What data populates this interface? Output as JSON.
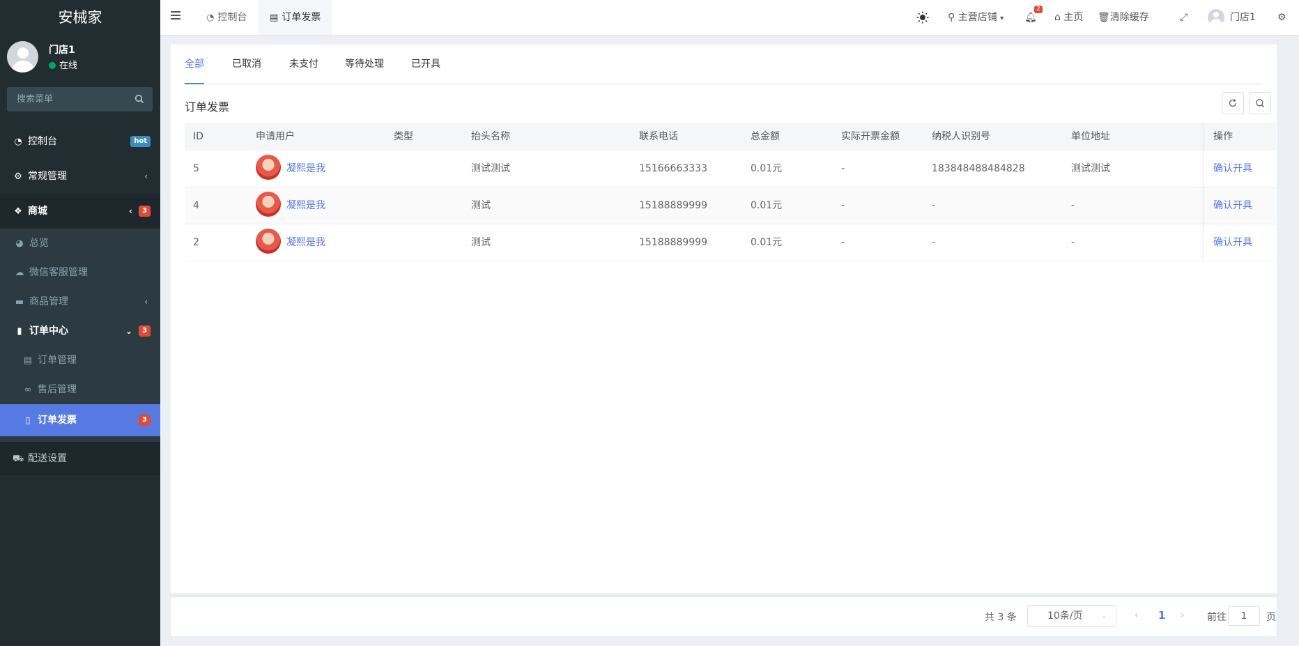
{
  "sidebar": {
    "logo": "安械家",
    "user": {
      "name": "门店1",
      "status": "在线"
    },
    "search_placeholder": "搜索菜单",
    "items": [
      {
        "label": "控制台",
        "icon": "dashboard-icon",
        "badge": "hot",
        "badge_color": "#3c8dbc"
      },
      {
        "label": "常规管理",
        "icon": "cogs-icon"
      },
      {
        "label": "商城",
        "icon": "dropbox-icon",
        "badge": "3",
        "badge_color": "#dd4b39"
      },
      {
        "label": "总览",
        "icon": "pie-chart-icon"
      },
      {
        "label": "微信客服管理",
        "icon": "comments-icon"
      },
      {
        "label": "商品管理",
        "icon": "archive-icon"
      },
      {
        "label": "订单中心",
        "icon": "file-icon",
        "badge": "3",
        "badge_color": "#dd4b39"
      },
      {
        "label": "订单管理",
        "icon": "file-text-icon"
      },
      {
        "label": "售后管理",
        "icon": "handshake-icon"
      },
      {
        "label": "订单发票",
        "icon": "file-text-o-icon",
        "badge": "3",
        "badge_color": "#dd4b39"
      },
      {
        "label": "配送设置",
        "icon": "car-icon"
      }
    ]
  },
  "topbar": {
    "tabs": [
      {
        "label": "控制台",
        "icon": "dashboard-icon"
      },
      {
        "label": "订单发票",
        "icon": "file-text-o-icon"
      }
    ],
    "store_label": "主营店铺",
    "notification_count": "2",
    "home_label": "主页",
    "clear_cache_label": "清除缓存",
    "user_name": "门店1"
  },
  "content": {
    "status_tabs": [
      "全部",
      "已取消",
      "未支付",
      "等待处理",
      "已开具"
    ],
    "title": "订单发票",
    "columns": [
      "ID",
      "申请用户",
      "类型",
      "抬头名称",
      "联系电话",
      "总金额",
      "实际开票金额",
      "纳税人识别号",
      "单位地址",
      "操作"
    ],
    "rows": [
      {
        "id": "5",
        "user": "凝熙是我",
        "type": "",
        "title": "测试测试",
        "phone": "15166663333",
        "total": "0.01元",
        "actual": "-",
        "tax": "183848488484828",
        "addr": "测试测试",
        "op": "确认开具"
      },
      {
        "id": "4",
        "user": "凝熙是我",
        "type": "",
        "title": "测试",
        "phone": "15188889999",
        "total": "0.01元",
        "actual": "-",
        "tax": "-",
        "addr": "-",
        "op": "确认开具"
      },
      {
        "id": "2",
        "user": "凝熙是我",
        "type": "",
        "title": "测试",
        "phone": "15188889999",
        "total": "0.01元",
        "actual": "-",
        "tax": "-",
        "addr": "-",
        "op": "确认开具"
      }
    ]
  },
  "pagination": {
    "total": "共 3 条",
    "page_size": "10条/页",
    "current_page": "1",
    "goto_label": "前往",
    "goto_value": "1",
    "goto_suffix": "页"
  },
  "colors": {
    "sidebar_bg": "#222d32",
    "accent": "#5779e2",
    "badge_red": "#dd4b39",
    "badge_blue": "#3c8dbc"
  }
}
